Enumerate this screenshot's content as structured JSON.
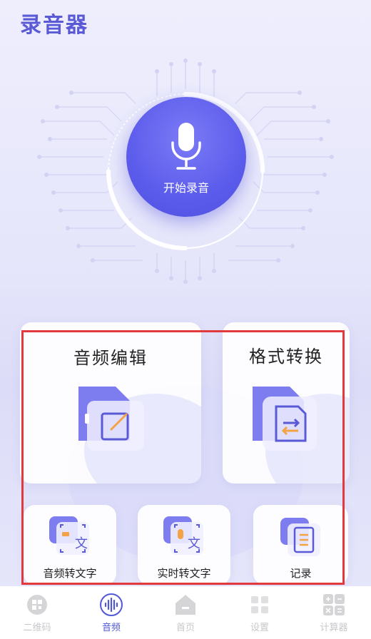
{
  "app": {
    "title": "录音器"
  },
  "record": {
    "label": "开始录音"
  },
  "features": {
    "audio_edit": "音频编辑",
    "format_convert": "格式转换",
    "audio_to_text": "音频转文字",
    "realtime_to_text": "实时转文字",
    "records": "记录"
  },
  "tabs": [
    {
      "label": "二维码",
      "icon": "qr-icon",
      "active": false
    },
    {
      "label": "音频",
      "icon": "audio-wave-icon",
      "active": true
    },
    {
      "label": "首页",
      "icon": "home-icon",
      "active": false
    },
    {
      "label": "设置",
      "icon": "settings-grid-icon",
      "active": false
    },
    {
      "label": "计算器",
      "icon": "calculator-icon",
      "active": false
    }
  ],
  "colors": {
    "accent": "#5a5ad6",
    "active_tab": "#5058d8",
    "inactive_tab": "#c8c8cc",
    "highlight": "#e4393c"
  }
}
